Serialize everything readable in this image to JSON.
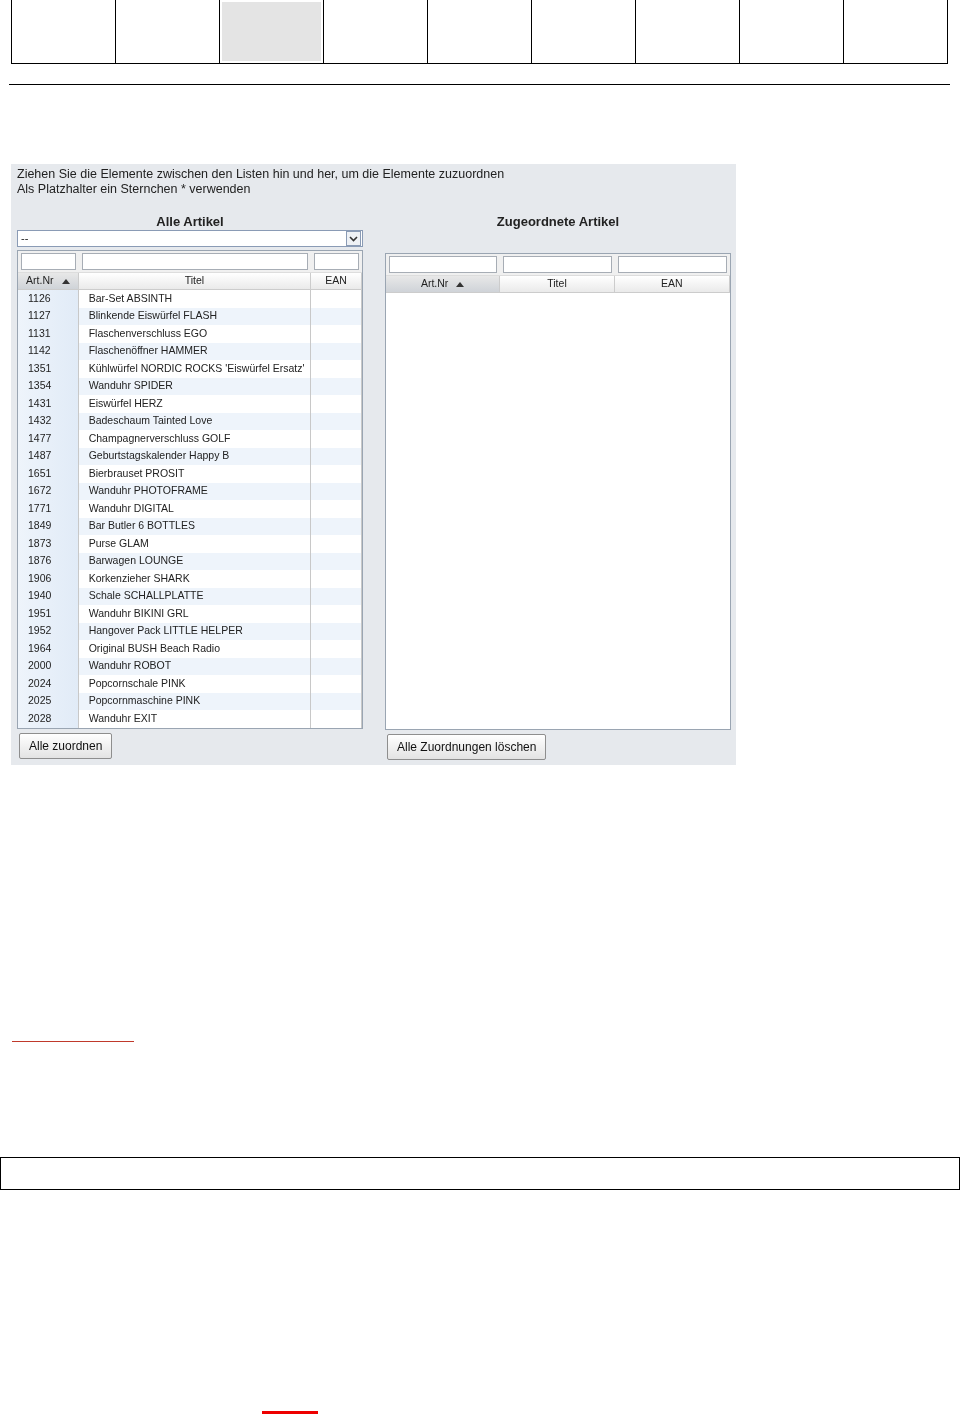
{
  "top_boxes": [
    {
      "selected": false
    },
    {
      "selected": false
    },
    {
      "selected": true
    },
    {
      "selected": false
    },
    {
      "selected": false
    },
    {
      "selected": false
    },
    {
      "selected": false
    },
    {
      "selected": false
    },
    {
      "selected": false
    }
  ],
  "panel": {
    "instructions": [
      "Ziehen Sie die Elemente zwischen den Listen hin und her, um die Elemente zuzuordnen",
      "Als Platzhalter ein Sternchen * verwenden"
    ],
    "left": {
      "title": "Alle Artikel",
      "dropdown": {
        "value": "--"
      },
      "columns": [
        {
          "label": "Art.Nr",
          "sorted": true
        },
        {
          "label": "Titel",
          "sorted": false
        },
        {
          "label": "EAN",
          "sorted": false
        }
      ],
      "rows": [
        {
          "art_nr": "1126",
          "titel": "Bar-Set ABSINTH"
        },
        {
          "art_nr": "1127",
          "titel": "Blinkende Eiswürfel FLASH"
        },
        {
          "art_nr": "1131",
          "titel": "Flaschenverschluss EGO"
        },
        {
          "art_nr": "1142",
          "titel": "Flaschenöffner HAMMER"
        },
        {
          "art_nr": "1351",
          "titel": "Kühlwürfel NORDIC ROCKS 'Eiswürfel Ersatz'"
        },
        {
          "art_nr": "1354",
          "titel": "Wanduhr SPIDER"
        },
        {
          "art_nr": "1431",
          "titel": "Eiswürfel HERZ"
        },
        {
          "art_nr": "1432",
          "titel": "Badeschaum Tainted Love"
        },
        {
          "art_nr": "1477",
          "titel": "Champagnerverschluss GOLF"
        },
        {
          "art_nr": "1487",
          "titel": "Geburtstagskalender Happy B"
        },
        {
          "art_nr": "1651",
          "titel": "Bierbrauset PROSIT"
        },
        {
          "art_nr": "1672",
          "titel": "Wanduhr PHOTOFRAME"
        },
        {
          "art_nr": "1771",
          "titel": "Wanduhr DIGITAL"
        },
        {
          "art_nr": "1849",
          "titel": "Bar Butler 6 BOTTLES"
        },
        {
          "art_nr": "1873",
          "titel": "Purse GLAM"
        },
        {
          "art_nr": "1876",
          "titel": "Barwagen LOUNGE"
        },
        {
          "art_nr": "1906",
          "titel": "Korkenzieher SHARK"
        },
        {
          "art_nr": "1940",
          "titel": "Schale SCHALLPLATTE"
        },
        {
          "art_nr": "1951",
          "titel": "Wanduhr BIKINI GRL"
        },
        {
          "art_nr": "1952",
          "titel": "Hangover Pack LITTLE HELPER"
        },
        {
          "art_nr": "1964",
          "titel": "Original BUSH Beach Radio"
        },
        {
          "art_nr": "2000",
          "titel": "Wanduhr ROBOT"
        },
        {
          "art_nr": "2024",
          "titel": "Popcornschale PINK"
        },
        {
          "art_nr": "2025",
          "titel": "Popcornmaschine PINK"
        },
        {
          "art_nr": "2028",
          "titel": "Wanduhr EXIT"
        }
      ],
      "button": "Alle zuordnen"
    },
    "right": {
      "title": "Zugeordnete Artikel",
      "columns": [
        {
          "label": "Art.Nr",
          "sorted": true
        },
        {
          "label": "Titel",
          "sorted": false
        },
        {
          "label": "EAN",
          "sorted": false
        }
      ],
      "button": "Alle Zuordnungen löschen"
    }
  }
}
